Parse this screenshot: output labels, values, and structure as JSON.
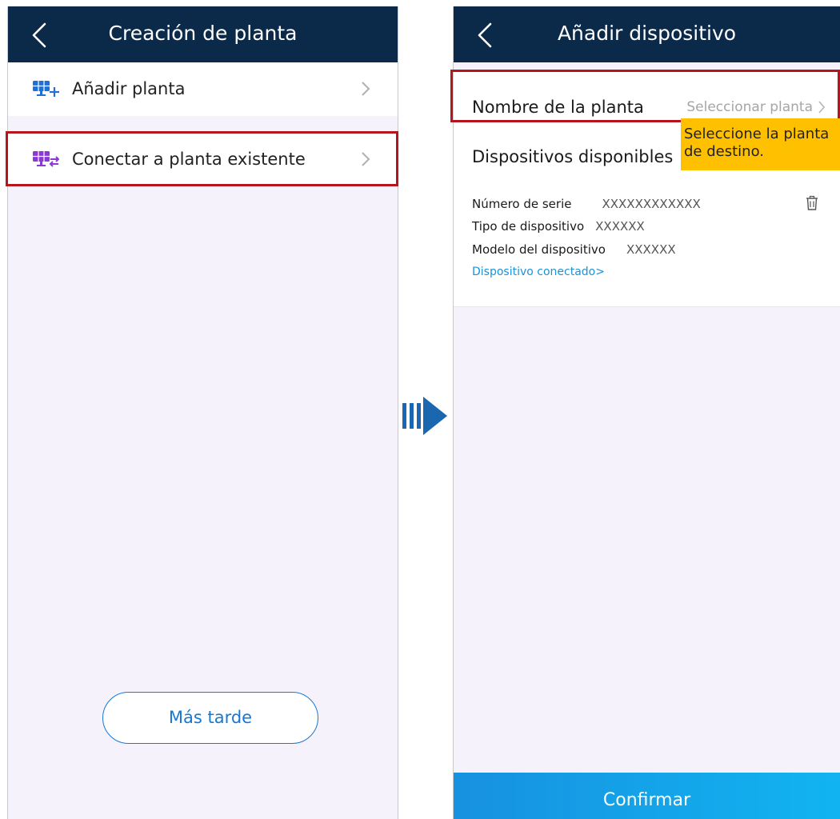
{
  "left_screen": {
    "title": "Creación de planta",
    "menu": [
      {
        "label": "Añadir planta",
        "icon": "solar-panel-add-icon"
      },
      {
        "label": "Conectar a planta existente",
        "icon": "solar-panel-connect-icon"
      }
    ],
    "later_button": "Más tarde"
  },
  "right_screen": {
    "title": "Añadir dispositivo",
    "plant_name": {
      "label": "Nombre de la planta",
      "placeholder": "Seleccionar planta"
    },
    "devices": {
      "title": "Dispositivos disponibles",
      "serial": {
        "label": "Número de serie",
        "value": "XXXXXXXXXXXX"
      },
      "type": {
        "label": "Tipo de dispositivo",
        "value": "XXXXXX"
      },
      "model": {
        "label": "Modelo del dispositivo",
        "value": "XXXXXX"
      },
      "link": "Dispositivo conectado>"
    },
    "tooltip": {
      "line1": "Seleccione la planta",
      "line2": "de destino."
    },
    "confirm_button": "Confirmar"
  },
  "colors": {
    "header": "#0b2a4a",
    "background": "#f5f2fc",
    "highlight": "#b5161e",
    "accent_blue": "#1478d4",
    "tooltip": "#ffc000",
    "link": "#1a93d9"
  }
}
